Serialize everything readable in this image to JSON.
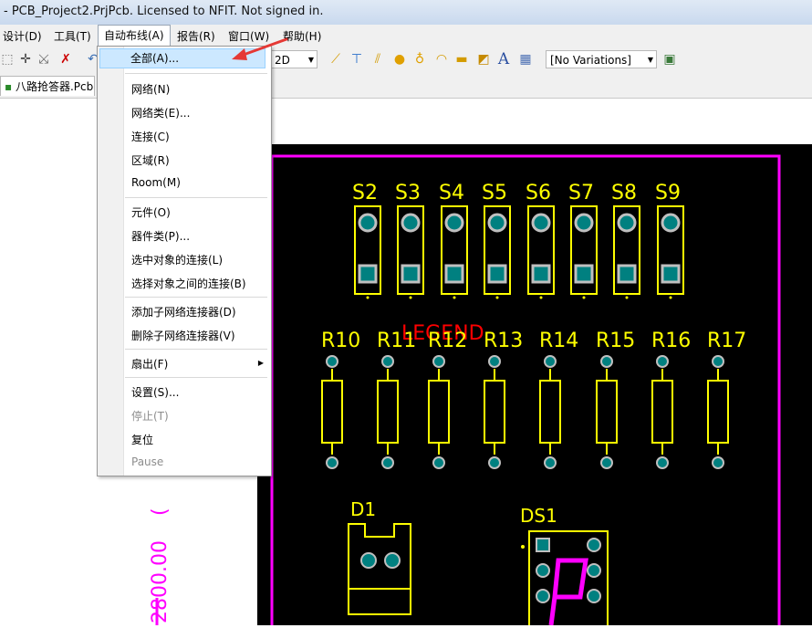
{
  "window": {
    "title": "- PCB_Project2.PrjPcb. Licensed to NFIT. Not signed in."
  },
  "menubar": {
    "design": "设计(D)",
    "tools": "工具(T)",
    "autoroute": "自动布线(A)",
    "reports": "报告(R)",
    "window": "窗口(W)",
    "help": "帮助(H)"
  },
  "toolbar": {
    "view_mode": "2D",
    "variations": "[No Variations]"
  },
  "tabs": [
    {
      "label": "八路抢答器.PcbDoc"
    }
  ],
  "autoroute_menu": {
    "items": [
      {
        "label": "全部(A)..."
      },
      {
        "label": "网络(N)"
      },
      {
        "label": "网络类(E)..."
      },
      {
        "label": "连接(C)"
      },
      {
        "label": "区域(R)"
      },
      {
        "label": "Room(M)"
      },
      {
        "label": "元件(O)"
      },
      {
        "label": "器件类(P)..."
      },
      {
        "label": "选中对象的连接(L)"
      },
      {
        "label": "选择对象之间的连接(B)"
      },
      {
        "label": "添加子网络连接器(D)"
      },
      {
        "label": "删除子网络连接器(V)"
      },
      {
        "label": "扇出(F)"
      },
      {
        "label": "设置(S)..."
      },
      {
        "label": "停止(T)"
      },
      {
        "label": "复位"
      },
      {
        "label": "Pause"
      }
    ]
  },
  "pcb": {
    "switches": [
      "S2",
      "S3",
      "S4",
      "S5",
      "S6",
      "S7",
      "S8",
      "S9"
    ],
    "resistors": [
      "R10",
      "R11",
      "R12",
      "R13",
      "R14",
      "R15",
      "R16",
      "R17"
    ],
    "legend_label": "LEGEND",
    "diode": "D1",
    "display": "DS1",
    "dimension": "2800.00",
    "colors": {
      "board": "#000000",
      "outline": "#ff00ff",
      "silk": "#ffff00",
      "pad": "#008080",
      "legend": "#ff0000"
    }
  }
}
